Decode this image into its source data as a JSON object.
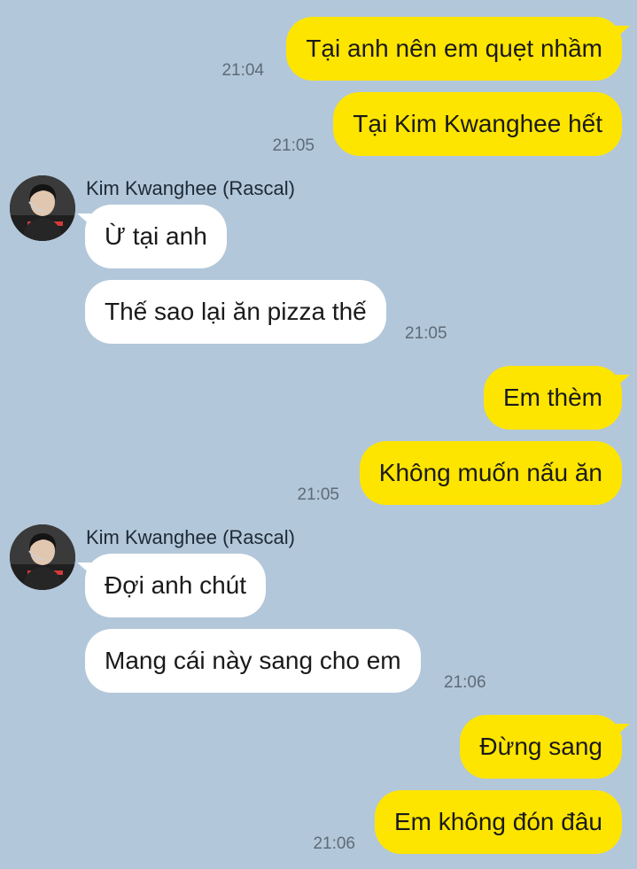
{
  "contact": {
    "name": "Kim Kwanghee (Rascal)",
    "avatar_icon": "person-avatar-icon"
  },
  "colors": {
    "background": "#b2c7da",
    "my_bubble": "#fee500",
    "their_bubble": "#ffffff"
  },
  "messages": [
    {
      "from": "me",
      "text": "Tại anh nên em quẹt nhầm",
      "time": "21:04"
    },
    {
      "from": "me",
      "text": "Tại Kim Kwanghee hết",
      "time": "21:05"
    },
    {
      "from": "them",
      "text": "Ừ tại anh",
      "time": ""
    },
    {
      "from": "them",
      "text": "Thế sao lại ăn pizza thế",
      "time": "21:05"
    },
    {
      "from": "me",
      "text": "Em thèm",
      "time": ""
    },
    {
      "from": "me",
      "text": "Không muốn nấu ăn",
      "time": "21:05"
    },
    {
      "from": "them",
      "text": "Đợi anh chút",
      "time": ""
    },
    {
      "from": "them",
      "text": "Mang cái này sang cho em",
      "time": "21:06"
    },
    {
      "from": "me",
      "text": "Đừng sang",
      "time": ""
    },
    {
      "from": "me",
      "text": "Em không đón đâu",
      "time": "21:06"
    }
  ]
}
